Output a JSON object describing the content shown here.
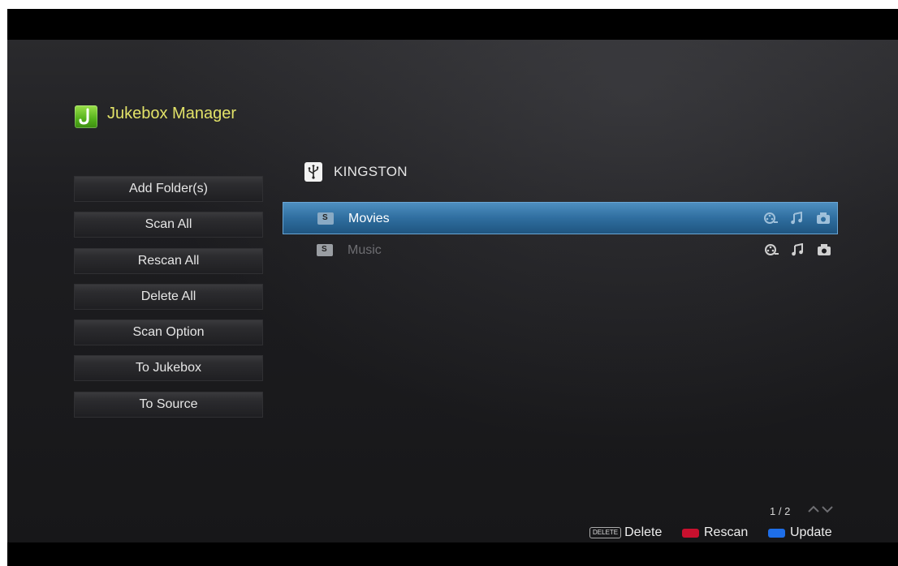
{
  "app": {
    "title": "Jukebox Manager",
    "logo_letter": "J"
  },
  "sidebar": {
    "buttons": [
      {
        "label": "Add Folder(s)"
      },
      {
        "label": "Scan All"
      },
      {
        "label": "Rescan All"
      },
      {
        "label": "Delete All"
      },
      {
        "label": "Scan Option"
      },
      {
        "label": "To Jukebox"
      },
      {
        "label": "To Source"
      }
    ]
  },
  "device": {
    "icon": "usb-icon",
    "name": "KINGSTON"
  },
  "folders": [
    {
      "label": "Movies",
      "icon_letter": "S",
      "selected": true,
      "media_icons": [
        "video-reel-icon",
        "music-note-icon",
        "camera-icon"
      ]
    },
    {
      "label": "Music",
      "icon_letter": "S",
      "selected": false,
      "media_icons": [
        "video-reel-icon",
        "music-note-icon",
        "camera-icon"
      ]
    }
  ],
  "paging": {
    "indicator": "1 / 2"
  },
  "legend": {
    "delete_key": "DELETE",
    "delete_label": "Delete",
    "rescan_label": "Rescan",
    "update_label": "Update"
  },
  "colors": {
    "title": "#e2e268",
    "selection": "#2f6e9f",
    "rescan": "#c8102e",
    "update": "#1e6ee8"
  }
}
